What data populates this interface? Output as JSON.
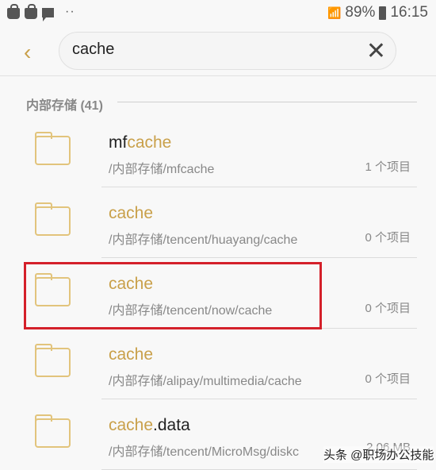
{
  "status_bar": {
    "battery": "89%",
    "time": "16:15",
    "network": "3G",
    "icons": [
      "shopping-bag-icon",
      "shopping-bag-icon",
      "message-icon",
      "more-dots-icon",
      "wifi-icon",
      "signal-icon",
      "battery-icon"
    ]
  },
  "header": {
    "back_icon": "chevron-left-icon",
    "search_value": "cache",
    "clear_icon": "close-icon"
  },
  "section": {
    "label": "内部存储 (41)"
  },
  "accent_color": "#c9a04a",
  "results": [
    {
      "pre": "mf",
      "match": "cache",
      "post": "",
      "path": "/内部存储/mfcache",
      "meta": "1 个项目"
    },
    {
      "pre": "",
      "match": "cache",
      "post": "",
      "path": "/内部存储/tencent/huayang/cache",
      "meta": "0 个项目"
    },
    {
      "pre": "",
      "match": "cache",
      "post": "",
      "path": "/内部存储/tencent/now/cache",
      "meta": "0 个项目",
      "highlighted": true
    },
    {
      "pre": "",
      "match": "cache",
      "post": "",
      "path": "/内部存储/alipay/multimedia/cache",
      "meta": "0 个项目"
    },
    {
      "pre": "",
      "match": "cache",
      "post": ".data",
      "path": "/内部存储/tencent/MicroMsg/diskc",
      "meta": "2.06 MB"
    }
  ],
  "watermark": "头条 @职场办公技能"
}
